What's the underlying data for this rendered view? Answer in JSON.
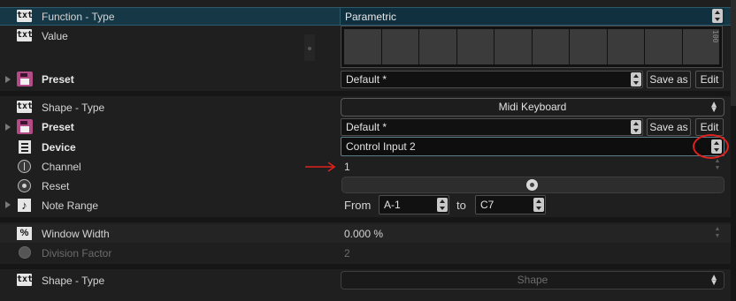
{
  "rows": {
    "function_type": {
      "label": "Function - Type",
      "value": "Parametric"
    },
    "value": {
      "label": "Value"
    },
    "preset1": {
      "label": "Preset",
      "value": "Default *",
      "save_label": "Save as",
      "edit_label": "Edit"
    },
    "shape_type": {
      "label": "Shape - Type",
      "value": "Midi Keyboard"
    },
    "preset2": {
      "label": "Preset",
      "value": "Default *",
      "save_label": "Save as",
      "edit_label": "Edit"
    },
    "device": {
      "label": "Device",
      "value": "Control Input 2"
    },
    "channel": {
      "label": "Channel",
      "value": "1"
    },
    "reset": {
      "label": "Reset"
    },
    "note_range": {
      "label": "Note Range",
      "from_label": "From",
      "from_value": "A-1",
      "to_label": "to",
      "to_value": "C7"
    },
    "window_width": {
      "label": "Window Width",
      "value": "0.000 %"
    },
    "division_factor": {
      "label": "Division Factor",
      "value": "2"
    },
    "shape_type2": {
      "label": "Shape - Type",
      "value": "Shape"
    }
  },
  "icons": {
    "txt": "txt",
    "percent": "%",
    "note": "♪"
  },
  "value_grid_top_label": "100",
  "value_grid_cells": 10,
  "colors": {
    "selected_row": "#163746",
    "annotation_red": "#e0201c",
    "preset_icon": "#b24b86"
  }
}
